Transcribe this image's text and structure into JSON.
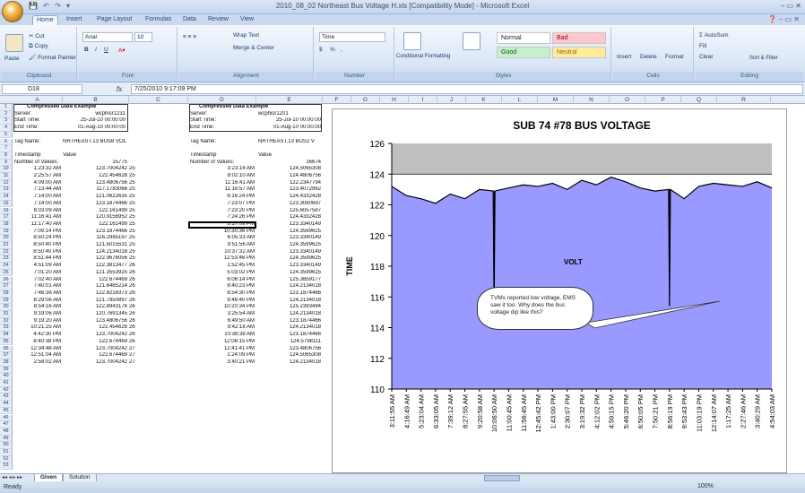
{
  "window": {
    "title": "2010_08_02 Northeast Bus Voltage H.xls  [Compatibility Mode] - Microsoft Excel",
    "buttons": "‒  ▭  ✕"
  },
  "qat": "💾 ↶ ↷ ▾",
  "tabs": [
    "Home",
    "Insert",
    "Page Layout",
    "Formulas",
    "Data",
    "Review",
    "View"
  ],
  "ribbon": {
    "clipboard": {
      "paste": "Paste",
      "cut": "Cut",
      "copy": "Copy",
      "format_painter": "Format Painter",
      "label": "Clipboard"
    },
    "font": {
      "name": "Arial",
      "size": "10",
      "bold": "B",
      "italic": "I",
      "underline": "U",
      "label": "Font"
    },
    "alignment": {
      "wrap": "Wrap Text",
      "merge": "Merge & Center",
      "label": "Alignment"
    },
    "number": {
      "format": "Time",
      "currency": "$",
      "percent": "%",
      "comma": ",",
      "label": "Number"
    },
    "styles": {
      "conditional": "Conditional Formatting",
      "format_table": "Format as Table",
      "normal": "Normal",
      "bad": "Bad",
      "good": "Good",
      "neutral": "Neutral",
      "label": "Styles"
    },
    "cells": {
      "insert": "Insert",
      "delete": "Delete",
      "format": "Format",
      "label": "Cells"
    },
    "editing": {
      "autosum": "AutoSum",
      "fill": "Fill",
      "clear": "Clear",
      "sort": "Sort & Filter",
      "find": "Find & Select",
      "label": "Editing"
    }
  },
  "formula_bar": {
    "name_box": "D18",
    "fx": "fx",
    "content": "7/25/2010 9:17:09 PM"
  },
  "columns": [
    "A",
    "B",
    "C",
    "D",
    "E",
    "F",
    "G",
    "H",
    "I",
    "J",
    "K",
    "L",
    "M",
    "N",
    "O",
    "P",
    "Q",
    "R"
  ],
  "block1": {
    "title": "Compressed Data Example",
    "server_label": "Server:",
    "server": "wcphisr1231",
    "start_label": "Start Time:",
    "start": "25-Jul-10 00:00:00",
    "end_label": "End Time:",
    "end": "01-Aug-10 00:00:00",
    "tag_label": "Tag Name:",
    "tag": "NRTHEAST.13 BUS8 VOLT",
    "ts_label": "Timestamp",
    "val_label": "Value",
    "count_label": "Number of Values:",
    "count": "15775",
    "rows": [
      [
        "1:23:32 AM",
        "123.7004242",
        "25"
      ],
      [
        "2:25:57 AM",
        "122.454628",
        "25"
      ],
      [
        "4:09:00 AM",
        "123.4806756",
        "25"
      ],
      [
        "7:13:44 AM",
        "117.1783066",
        "25"
      ],
      [
        "7:14:00 AM",
        "121.0622635",
        "25"
      ],
      [
        "7:14:00 AM",
        "123.1874466",
        "25"
      ],
      [
        "8:03:09 AM",
        "122.161499",
        "25"
      ],
      [
        "11:16:41 AM",
        "120.9156952",
        "25"
      ],
      [
        "11:17:40 AM",
        "122.161499",
        "25"
      ],
      [
        "7:09:14 PM",
        "123.1874466",
        "25"
      ],
      [
        "8:50:24 PM",
        "116.2985197",
        "25"
      ],
      [
        "8:50:40 PM",
        "121.5015531",
        "25"
      ],
      [
        "8:50:40 PM",
        "124.2134018",
        "25"
      ],
      [
        "8:51:44 PM",
        "122.9676056",
        "25"
      ],
      [
        "4:51:09 AM",
        "122.3813477",
        "26"
      ],
      [
        "7:01:20 AM",
        "121.3553925",
        "26"
      ],
      [
        "7:02:40 AM",
        "122.674469",
        "26"
      ],
      [
        "7:40:01 AM",
        "121.6485214",
        "26"
      ],
      [
        "7:46:38 AM",
        "122.8216373",
        "26"
      ],
      [
        "8:29:06 AM",
        "121.7950897",
        "26"
      ],
      [
        "8:54:16 AM",
        "122.8943176",
        "26"
      ],
      [
        "9:19:06 AM",
        "120.7691345",
        "26"
      ],
      [
        "9:19:20 AM",
        "123.4806756",
        "26"
      ],
      [
        "10:21:25 AM",
        "122.454628",
        "26"
      ],
      [
        "4:42:30 PM",
        "123.7004242",
        "26"
      ],
      [
        "8:40:38 PM",
        "122.674469",
        "26"
      ],
      [
        "12:34:48 AM",
        "123.7004242",
        "27"
      ],
      [
        "12:51:04 AM",
        "122.674469",
        "27"
      ],
      [
        "2:58:02 AM",
        "123.7004242",
        "27"
      ]
    ]
  },
  "block2": {
    "title": "Compressed Data Example",
    "server_label": "Server:",
    "server": "wcphisr1201",
    "start_label": "Start Time:",
    "start": "25-Jul-10 00:00:00",
    "end_label": "End Time:",
    "end": "01-Aug-10 00:00:00",
    "tag_label": "Tag Name:",
    "tag": "NRTHEAST.13 BUS2 V",
    "ts_label": "Timestamp",
    "val_label": "Value",
    "count_label": "Number of Values:",
    "count": "16674",
    "rows": [
      [
        "3:23:16 AM",
        "124.5065308"
      ],
      [
        "8:02:10 AM",
        "124.4806756"
      ],
      [
        "11:16:41 AM",
        "122.2347794"
      ],
      [
        "11:16:57 AM",
        "123.4072962"
      ],
      [
        "6:16:24 PM",
        "124.4332428"
      ],
      [
        "7:23:07 PM",
        "123.3080697"
      ],
      [
        "7:23:20 PM",
        "125.6057587"
      ],
      [
        "7:24:26 PM",
        "124.4332428"
      ],
      [
        "9:17:09 PM",
        "123.3340149"
      ],
      [
        "10:30:36 PM",
        "124.3599625"
      ],
      [
        "6:05:33 AM",
        "123.3340149"
      ],
      [
        "9:51:56 AM",
        "124.3599625"
      ],
      [
        "10:37:32 AM",
        "123.3340149"
      ],
      [
        "12:53:46 PM",
        "124.3599625"
      ],
      [
        "1:52:45 PM",
        "123.3340149"
      ],
      [
        "5:03:02 PM",
        "124.3599625"
      ],
      [
        "6:06:14 PM",
        "125.3859177"
      ],
      [
        "8:40:23 PM",
        "124.2134018"
      ],
      [
        "8:54:30 PM",
        "123.1874466"
      ],
      [
        "9:46:40 PM",
        "124.2134018"
      ],
      [
        "10:20:34 PM",
        "125.2393494"
      ],
      [
        "3:25:54 AM",
        "124.2134018"
      ],
      [
        "6:49:50 AM",
        "123.1874466"
      ],
      [
        "9:42:18 AM",
        "124.2134018"
      ],
      [
        "10:38:38 AM",
        "123.1874466"
      ],
      [
        "12:06:15 PM",
        "124.5798111"
      ],
      [
        "12:41:41 PM",
        "123.4806756"
      ],
      [
        "1:24:09 PM",
        "124.5065308"
      ],
      [
        "3:40:21 PM",
        "124.2134018"
      ]
    ]
  },
  "chart_data": {
    "type": "area",
    "title": "SUB 74 #78 BUS VOLTAGE",
    "ylabel": "TIME",
    "xlabel": "",
    "ylim": [
      110,
      126
    ],
    "yticks": [
      110,
      112,
      114,
      116,
      118,
      120,
      122,
      124,
      126
    ],
    "grid": false,
    "fill_color": "#9999ff",
    "upper_band_color": "#c0c0c0",
    "reference_line": 124,
    "x": [
      "3:11:55 AM",
      "4:16:49 AM",
      "5:23:04 AM",
      "6:33:05 AM",
      "7:39:12 AM",
      "8:27:55 AM",
      "9:20:58 AM",
      "10:06:50 AM",
      "11:00:45 AM",
      "11:56:45 AM",
      "12:45:42 PM",
      "1:43:00 PM",
      "2:30:07 PM",
      "3:19:32 PM",
      "4:12:02 PM",
      "4:59:15 PM",
      "5:46:20 PM",
      "6:50:05 PM",
      "7:50:21 PM",
      "8:56:19 PM",
      "9:53:43 PM",
      "11:03:19 PM",
      "12:14:07 AM",
      "1:17:25 AM",
      "2:27:46 AM",
      "3:40:29 AM",
      "4:54:03 AM"
    ],
    "values": [
      123.2,
      122.6,
      122.4,
      122.1,
      122.7,
      122.4,
      123.0,
      122.9,
      123.1,
      123.3,
      123.2,
      123.4,
      123.0,
      123.6,
      123.3,
      123.8,
      123.5,
      123.1,
      122.9,
      123.0,
      122.4,
      123.2,
      123.4,
      123.3,
      123.2,
      123.5,
      123.1
    ],
    "dips": [
      {
        "x": "10:06:50 AM",
        "value": 115.2
      },
      {
        "x": "8:56:19 PM",
        "value": 115.4
      }
    ],
    "annotations": [
      "VOLT",
      "TVMs reported low voltage, EMS saw it too.  Why does the bus voltage dip like this?"
    ]
  },
  "sheets": [
    "Given",
    "Solution"
  ],
  "status": {
    "ready": "Ready",
    "zoom": "100%"
  }
}
